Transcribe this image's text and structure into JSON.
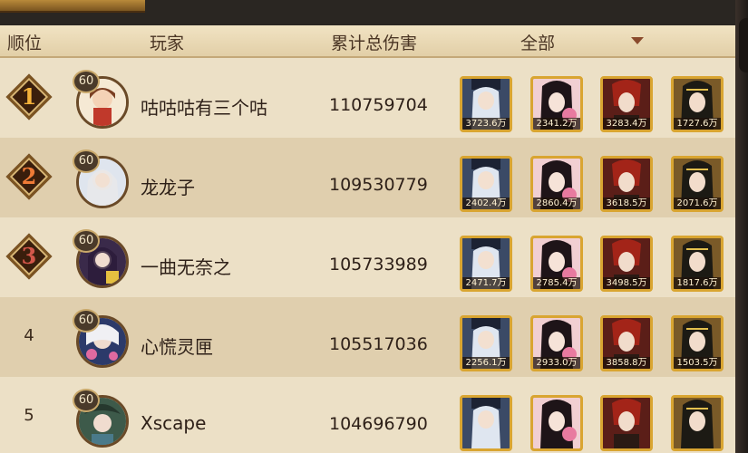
{
  "header": {
    "rank_label": "顺位",
    "player_label": "玩家",
    "damage_label": "累计总伤害",
    "filter_label": "全部"
  },
  "rows": [
    {
      "rank": "1",
      "level": "60",
      "name": "咕咕咕有三个咕",
      "damage": "110759704",
      "cards": [
        "3723.6万",
        "2341.2万",
        "3283.4万",
        "1727.6万"
      ]
    },
    {
      "rank": "2",
      "level": "60",
      "name": "龙龙子",
      "damage": "109530779",
      "cards": [
        "2402.4万",
        "2860.4万",
        "3618.5万",
        "2071.6万"
      ]
    },
    {
      "rank": "3",
      "level": "60",
      "name": "一曲无奈之",
      "damage": "105733989",
      "cards": [
        "2471.7万",
        "2785.4万",
        "3498.5万",
        "1817.6万"
      ]
    },
    {
      "rank": "4",
      "level": "60",
      "name": "心慌灵匣",
      "damage": "105517036",
      "cards": [
        "2256.1万",
        "2933.0万",
        "3858.8万",
        "1503.5万"
      ]
    },
    {
      "rank": "5",
      "level": "60",
      "name": "Xscape",
      "damage": "104696790",
      "cards": [
        "",
        "",
        "",
        ""
      ]
    }
  ]
}
